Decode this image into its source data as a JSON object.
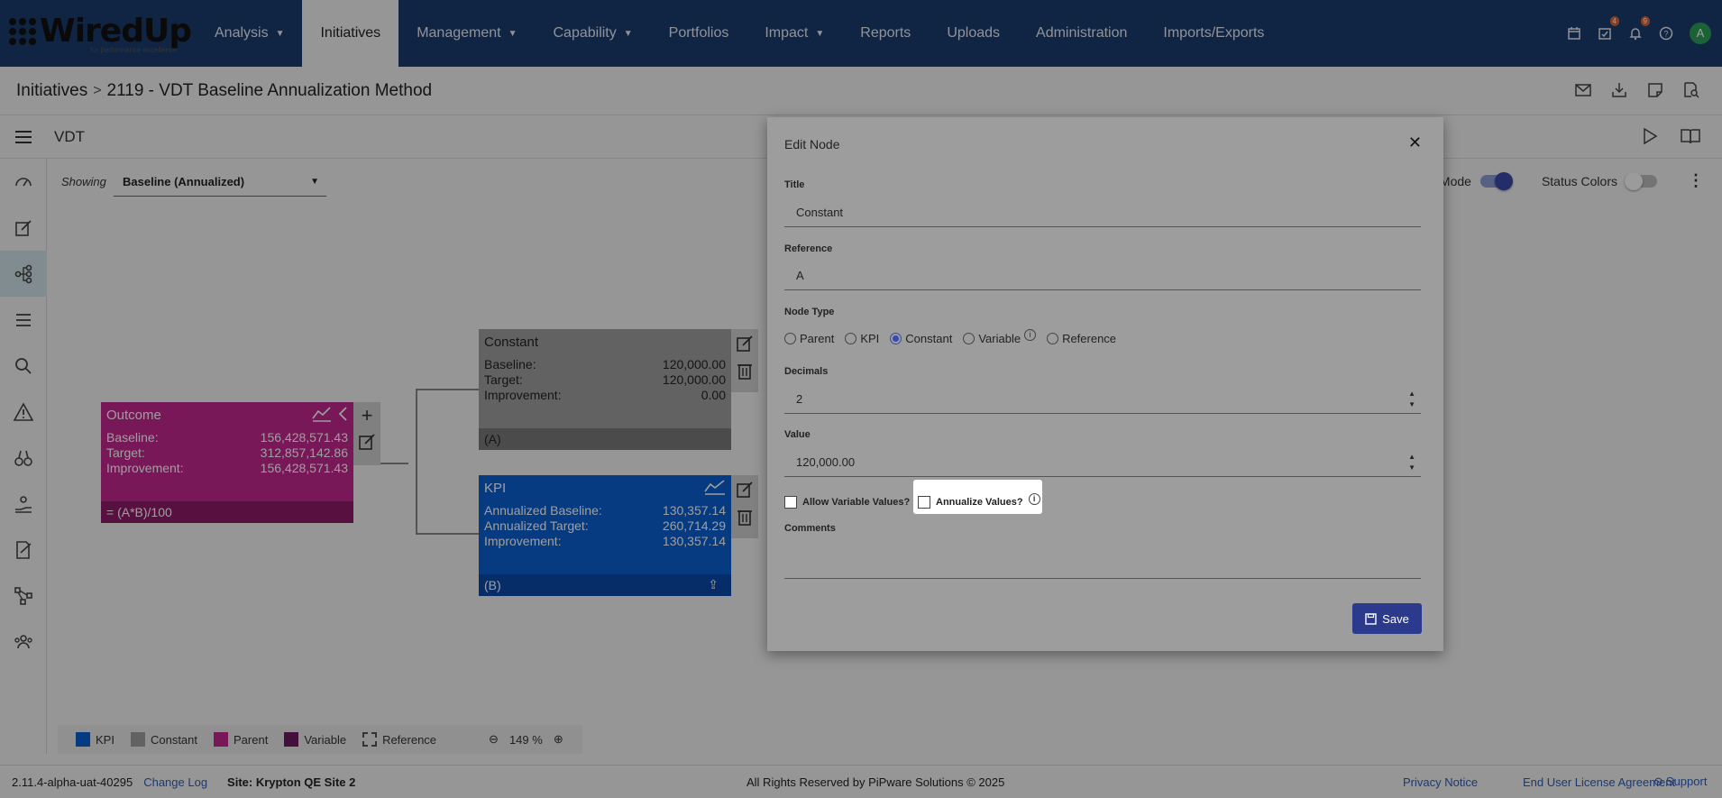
{
  "app": {
    "logo_text": "WiredUp",
    "logo_tagline": "for performance excellence"
  },
  "nav": {
    "items": [
      {
        "label": "Analysis",
        "has_caret": true
      },
      {
        "label": "Initiatives",
        "has_caret": false,
        "active": true
      },
      {
        "label": "Management",
        "has_caret": true
      },
      {
        "label": "Capability",
        "has_caret": true
      },
      {
        "label": "Portfolios",
        "has_caret": false
      },
      {
        "label": "Impact",
        "has_caret": true
      },
      {
        "label": "Reports",
        "has_caret": false
      },
      {
        "label": "Uploads",
        "has_caret": false
      },
      {
        "label": "Administration",
        "has_caret": false
      },
      {
        "label": "Imports/Exports",
        "has_caret": false
      }
    ],
    "icons": [
      "calendar-icon",
      "tasks-icon",
      "bell-icon",
      "help-icon"
    ],
    "tasks_badge": "4",
    "bell_badge": "9",
    "avatar_letter": "A"
  },
  "breadcrumb": {
    "root": "Initiatives",
    "separator": ">",
    "current": "2119 - VDT Baseline Annualization Method"
  },
  "vdt": {
    "title": "VDT"
  },
  "canvas": {
    "showing_label": "Showing",
    "showing_value": "Baseline (Annualized)",
    "edit_mode_label": "Edit Mode",
    "edit_mode_partial": "t Mode",
    "status_colors_label": "Status Colors",
    "edit_mode_on": true,
    "status_colors_on": false
  },
  "nodes": {
    "outcome": {
      "title": "Outcome",
      "rows": [
        {
          "label": "Baseline:",
          "value": "156,428,571.43"
        },
        {
          "label": "Target:",
          "value": "312,857,142.86"
        },
        {
          "label": "Improvement:",
          "value": "156,428,571.43"
        }
      ],
      "formula": "= (A*B)/100"
    },
    "constant": {
      "title": "Constant",
      "rows": [
        {
          "label": "Baseline:",
          "value": "120,000.00"
        },
        {
          "label": "Target:",
          "value": "120,000.00"
        },
        {
          "label": "Improvement:",
          "value": "0.00"
        }
      ],
      "ref": "(A)"
    },
    "kpi": {
      "title": "KPI",
      "rows": [
        {
          "label": "Annualized Baseline:",
          "value": "130,357.14"
        },
        {
          "label": "Annualized Target:",
          "value": "260,714.29"
        },
        {
          "label": "Improvement:",
          "value": "130,357.14"
        }
      ],
      "ref": "(B)"
    }
  },
  "legend": {
    "items": [
      {
        "label": "KPI",
        "color": "#0a5fd0"
      },
      {
        "label": "Constant",
        "color": "#9e9e9e"
      },
      {
        "label": "Parent",
        "color": "#c2288e"
      },
      {
        "label": "Variable",
        "color": "#6b1a5c"
      },
      {
        "label": "Reference",
        "color": "dashed"
      }
    ],
    "zoom": "149 %"
  },
  "footer": {
    "version": "2.11.4-alpha-uat-40295",
    "change_log": "Change Log",
    "site": "Site: Krypton QE Site 2",
    "copyright": "All Rights Reserved by PiPware Solutions © 2025",
    "privacy": "Privacy Notice",
    "eula": "End User License Agreement",
    "support": "Support"
  },
  "modal": {
    "title": "Edit Node",
    "title_label": "Title",
    "title_value": "Constant",
    "reference_label": "Reference",
    "reference_value": "A",
    "node_type_label": "Node Type",
    "node_types": [
      {
        "label": "Parent",
        "checked": false
      },
      {
        "label": "KPI",
        "checked": false
      },
      {
        "label": "Constant",
        "checked": true
      },
      {
        "label": "Variable",
        "checked": false,
        "info": true
      },
      {
        "label": "Reference",
        "checked": false
      }
    ],
    "decimals_label": "Decimals",
    "decimals_value": "2",
    "value_label": "Value",
    "value_value": "120,000.00",
    "allow_variable_label": "Allow Variable Values?",
    "annualize_label": "Annualize Values?",
    "comments_label": "Comments",
    "save_label": "Save"
  }
}
